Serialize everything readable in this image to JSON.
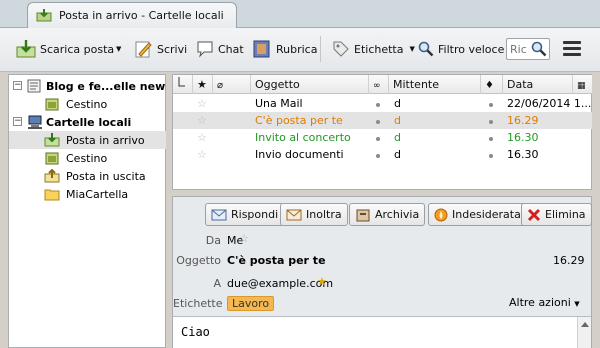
{
  "tab": {
    "title": "Posta in arrivo - Cartelle locali"
  },
  "toolbar": {
    "get_mail": "Scarica posta",
    "write": "Scrivi",
    "chat": "Chat",
    "address_book": "Rubrica",
    "tag": "Etichetta",
    "quick_filter": "Filtro veloce",
    "search_placeholder": "Ric"
  },
  "folders": {
    "accounts": [
      {
        "name": "Blog e fe...elle news",
        "folders": [
          "Cestino"
        ]
      },
      {
        "name": "Cartelle locali",
        "folders": [
          "Posta in arrivo",
          "Cestino",
          "Posta in uscita",
          "MiaCartella"
        ]
      }
    ],
    "selected": "Posta in arrivo"
  },
  "threads": {
    "columns": {
      "subject": "Oggetto",
      "from": "Mittente",
      "date": "Data"
    },
    "rows": [
      {
        "subject": "Una Mail",
        "from": "d",
        "date": "22/06/2014 1..."
      },
      {
        "subject": "C'è posta per te",
        "from": "d",
        "date": "16.29"
      },
      {
        "subject": "Invito al concerto",
        "from": "d",
        "date": "16.30"
      },
      {
        "subject": "Invio documenti",
        "from": "d",
        "date": "16.30"
      }
    ]
  },
  "message": {
    "actions": {
      "reply": "Rispondi",
      "forward": "Inoltra",
      "archive": "Archivia",
      "junk": "Indesiderata",
      "delete": "Elimina"
    },
    "labels": {
      "from": "Da",
      "subject": "Oggetto",
      "to": "A",
      "tags": "Etichette"
    },
    "from": "Me",
    "subject": "C'è posta per te",
    "time": "16.29",
    "to": "due@example.com",
    "tag": "Lavoro",
    "other_actions": "Altre azioni",
    "body": "Ciao"
  },
  "colors": {
    "tag": "#f5b850",
    "unread_orange": "#e07b00",
    "green": "#1f9a1f"
  }
}
